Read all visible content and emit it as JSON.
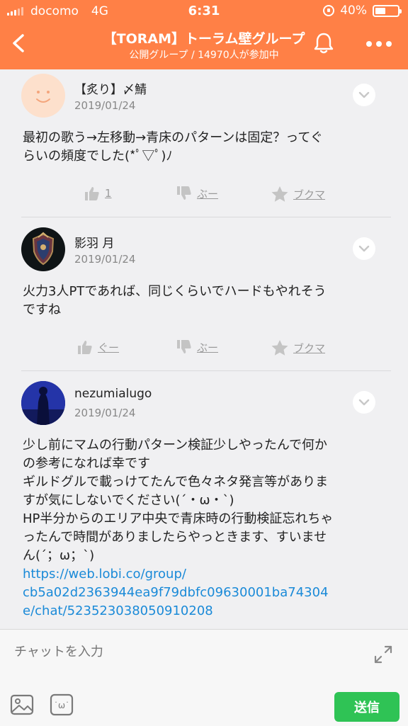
{
  "status_bar": {
    "carrier": "docomo",
    "network": "4G",
    "time": "6:31",
    "battery": "40%"
  },
  "header": {
    "title": "【TORAM】トーラム壁グループ",
    "subtitle": "公開グループ / 14970人が参加中",
    "icons": [
      "back-arrow-icon",
      "bell-icon",
      "more-icon"
    ]
  },
  "posts": [
    {
      "name": "【炙り】〆鯖",
      "date": "2019/01/24",
      "text": [
        "最初の歌う→左移動→青床のパターンは固定？ってぐ",
        "らいの頻度でした(*ﾟ▽ﾟ)ﾉ"
      ],
      "actions": {
        "good": "1",
        "bad": "ぶー",
        "bookmark": "ブクマ"
      }
    },
    {
      "name": "影羽 月",
      "date": "2019/01/24",
      "text": [
        "火力3人PTであれば、同じくらいでハードもやれそう",
        "ですね"
      ],
      "actions": {
        "good": "ぐー",
        "bad": "ぶー",
        "bookmark": "ブクマ"
      }
    },
    {
      "name": "nezumialugo",
      "date": "2019/01/24",
      "text": [
        "少し前にマムの行動パターン検証少しやったんで何か",
        "の参考になれば幸です",
        "ギルドグルで載っけてたんで色々ネタ発言等がありま",
        "すが気にしないでください(´・ω・`)",
        "HP半分からのエリア中央で青床時の行動検証忘れちゃ",
        "ったんで時間がありましたらやっときます、すいませ",
        "ん(´；ω；`)"
      ],
      "link": [
        "https://web.lobi.co/group/",
        "cb5a02d2363944ea9f79dbfc09630001ba74304",
        "e/chat/523523038050910208"
      ]
    }
  ],
  "composer": {
    "placeholder": "チャットを入力",
    "send_label": "送信"
  },
  "colors": {
    "header": "#ff8046",
    "link": "#1a8ad8",
    "send": "#2fc355"
  }
}
